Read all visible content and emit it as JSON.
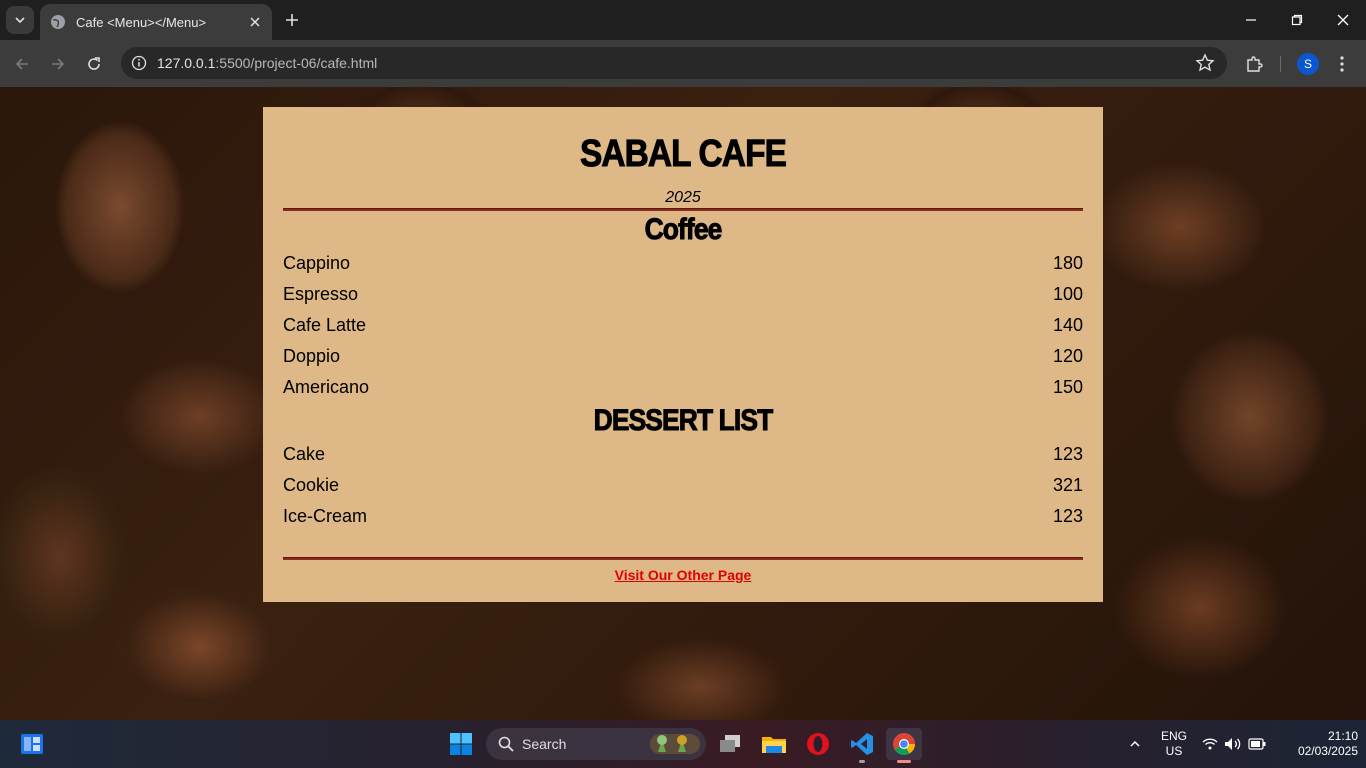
{
  "browser": {
    "tab_title": "Cafe <Menu></Menu>",
    "url_host": "127.0.0.1",
    "url_rest": ":5500/project-06/cafe.html",
    "profile_initial": "S"
  },
  "menu": {
    "cafe_name": "SABAL CAFE",
    "year": "2025",
    "sections": [
      {
        "title": "Coffee",
        "items": [
          {
            "name": "Cappino",
            "price": "180"
          },
          {
            "name": "Espresso",
            "price": "100"
          },
          {
            "name": "Cafe Latte",
            "price": "140"
          },
          {
            "name": "Doppio",
            "price": "120"
          },
          {
            "name": "Americano",
            "price": "150"
          }
        ]
      },
      {
        "title": "DESSERT LIST",
        "items": [
          {
            "name": "Cake",
            "price": "123"
          },
          {
            "name": "Cookie",
            "price": "321"
          },
          {
            "name": "Ice-Cream",
            "price": "123"
          }
        ]
      }
    ],
    "footer_link": "Visit Our Other Page"
  },
  "taskbar": {
    "search_label": "Search",
    "lang_top": "ENG",
    "lang_bottom": "US",
    "time": "21:10",
    "date": "02/03/2025"
  },
  "colors": {
    "card_bg": "#deb887",
    "rule": "#8b2b1e",
    "link": "#e00000"
  }
}
